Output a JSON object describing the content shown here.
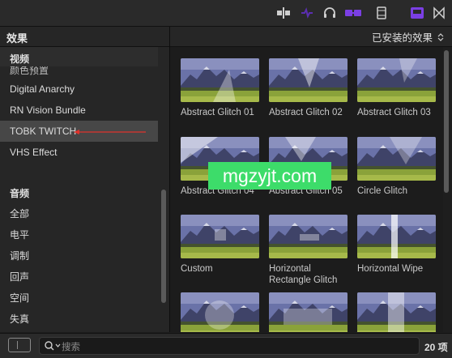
{
  "toolbar": {
    "icons": [
      "split-edit-icon",
      "audio-skimming-icon",
      "headphones-icon",
      "solo-icon",
      "filmstrip-icon",
      "effects-browser-icon",
      "transitions-icon"
    ],
    "accent": "#7b3fe4"
  },
  "sidebar": {
    "title": "效果",
    "video_header": "视频",
    "video_items": [
      {
        "label": "颜色预置",
        "partial": true
      },
      {
        "label": "Digital Anarchy"
      },
      {
        "label": "RN Vision Bundle"
      },
      {
        "label": "TOBK TWITCH",
        "selected": true
      },
      {
        "label": "VHS Effect"
      }
    ],
    "audio_header": "音频",
    "audio_items": [
      {
        "label": "全部"
      },
      {
        "label": "电平"
      },
      {
        "label": "调制"
      },
      {
        "label": "回声"
      },
      {
        "label": "空间"
      },
      {
        "label": "失真"
      }
    ],
    "selection_color": "#474747",
    "annotation_color": "#e0332c"
  },
  "content": {
    "filter_label": "已安装的效果",
    "tiles": [
      {
        "caption": "Abstract Glitch 01",
        "variant": "tri1"
      },
      {
        "caption": "Abstract Glitch 02",
        "variant": "tri2"
      },
      {
        "caption": "Abstract Glitch 03",
        "variant": "tri3"
      },
      {
        "caption": "Abstract Glitch 04",
        "variant": "tri4"
      },
      {
        "caption": "Abstract Glitch 05",
        "variant": "tri5"
      },
      {
        "caption": "Circle Glitch",
        "variant": "tri6"
      },
      {
        "caption": "Custom",
        "variant": "sq1"
      },
      {
        "caption": "Horizontal\nRectangle Glitch",
        "variant": "rect"
      },
      {
        "caption": "Horizontal Wipe",
        "variant": "vbar"
      },
      {
        "caption": "",
        "variant": "circle"
      },
      {
        "caption": "",
        "variant": "wide"
      },
      {
        "caption": "",
        "variant": "vbar2"
      }
    ]
  },
  "watermark": "mgzyjt.com",
  "footer": {
    "search_placeholder": "搜索",
    "count": "20 项"
  }
}
